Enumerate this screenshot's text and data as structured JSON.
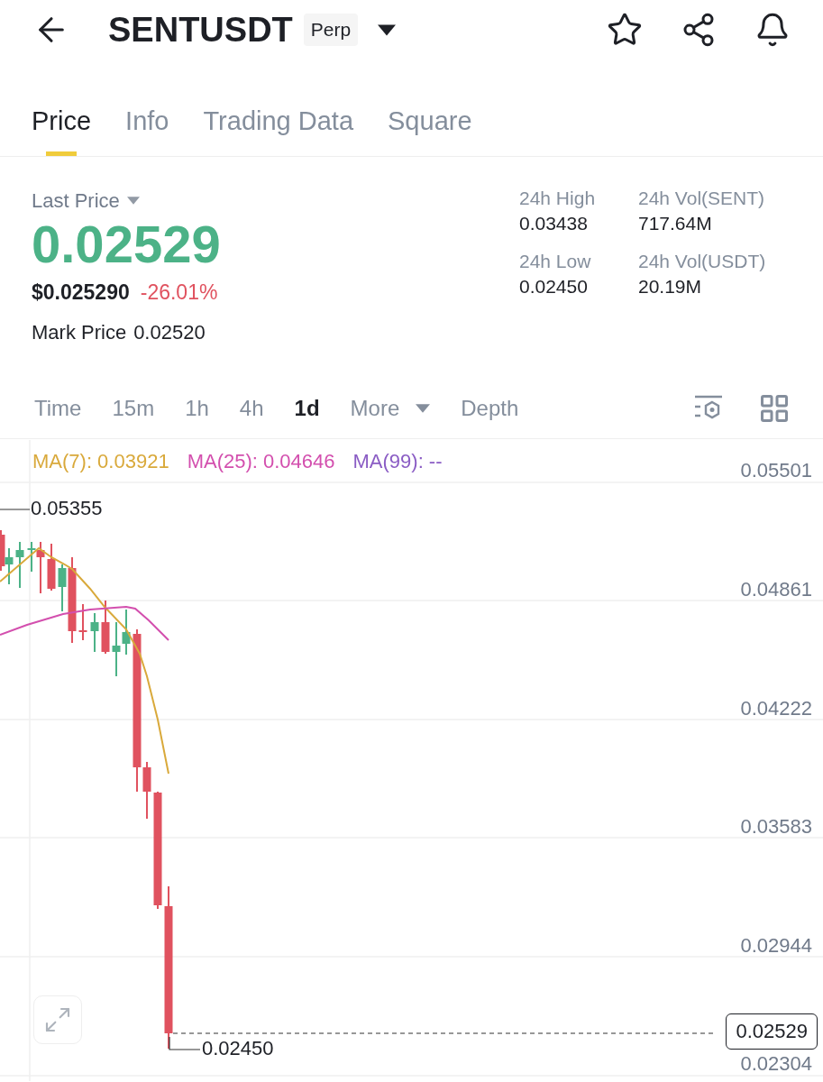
{
  "header": {
    "title": "SENTUSDT",
    "badge": "Perp"
  },
  "tabs": [
    {
      "label": "Price",
      "selected": true
    },
    {
      "label": "Info",
      "selected": false
    },
    {
      "label": "Trading Data",
      "selected": false
    },
    {
      "label": "Square",
      "selected": false
    }
  ],
  "ticker": {
    "last_price_label": "Last Price",
    "last_price": "0.02529",
    "usd_price": "$0.025290",
    "change": "-26.01%",
    "mark_price_label": "Mark Price",
    "mark_price": "0.02520",
    "stats": [
      {
        "label": "24h High",
        "value": "0.03438"
      },
      {
        "label": "24h Vol(SENT)",
        "value": "717.64M"
      },
      {
        "label": "24h Low",
        "value": "0.02450"
      },
      {
        "label": "24h Vol(USDT)",
        "value": "20.19M"
      }
    ]
  },
  "intervals": [
    {
      "label": "Time",
      "selected": false,
      "kind": "text"
    },
    {
      "label": "15m",
      "selected": false,
      "kind": "text"
    },
    {
      "label": "1h",
      "selected": false,
      "kind": "text"
    },
    {
      "label": "4h",
      "selected": false,
      "kind": "text"
    },
    {
      "label": "1d",
      "selected": true,
      "kind": "text"
    },
    {
      "label": "More",
      "selected": false,
      "kind": "dropdown"
    },
    {
      "label": "Depth",
      "selected": false,
      "kind": "text"
    }
  ],
  "indicators": [
    {
      "label": "MA(7): 0.03921",
      "color": "#d9a93b"
    },
    {
      "label": "MA(25): 0.04646",
      "color": "#d34fae"
    },
    {
      "label": "MA(99): --",
      "color": "#8a5cc4"
    }
  ],
  "chart": {
    "price_axis": [
      "0.05501",
      "0.04861",
      "0.04222",
      "0.03583",
      "0.02944",
      "0.02304"
    ],
    "high_label": "0.05355",
    "low_label": "0.02450",
    "last_price_tag": "0.02529"
  }
}
